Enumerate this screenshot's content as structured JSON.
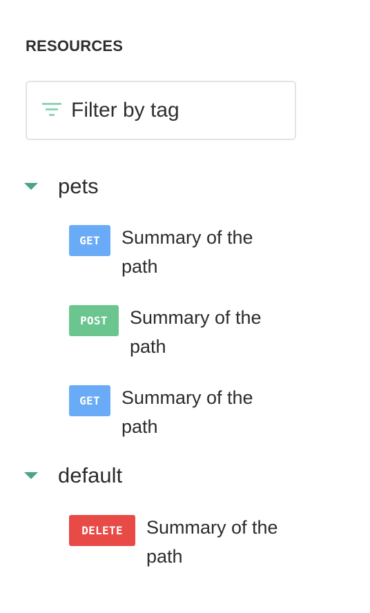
{
  "sidebar": {
    "title": "RESOURCES",
    "filter": {
      "placeholder": "Filter by tag",
      "icon": "filter-icon",
      "icon_color": "#8fd4b4"
    },
    "groups": [
      {
        "name": "pets",
        "expanded": true,
        "caret_icon": "caret-down-icon",
        "operations": [
          {
            "method": "GET",
            "color": "#6aabf7",
            "summary_line1": "Summary of the",
            "summary_line2": "path"
          },
          {
            "method": "POST",
            "color": "#6ac68e",
            "summary_line1": "Summary of the",
            "summary_line2": "path"
          },
          {
            "method": "GET",
            "color": "#6aabf7",
            "summary_line1": "Summary of the",
            "summary_line2": "path"
          }
        ]
      },
      {
        "name": "default",
        "expanded": true,
        "caret_icon": "caret-down-icon",
        "operations": [
          {
            "method": "DELETE",
            "color": "#e84a45",
            "summary_line1": "Summary of the",
            "summary_line2": "path"
          }
        ]
      }
    ],
    "accent_color": "#4aa48a"
  }
}
